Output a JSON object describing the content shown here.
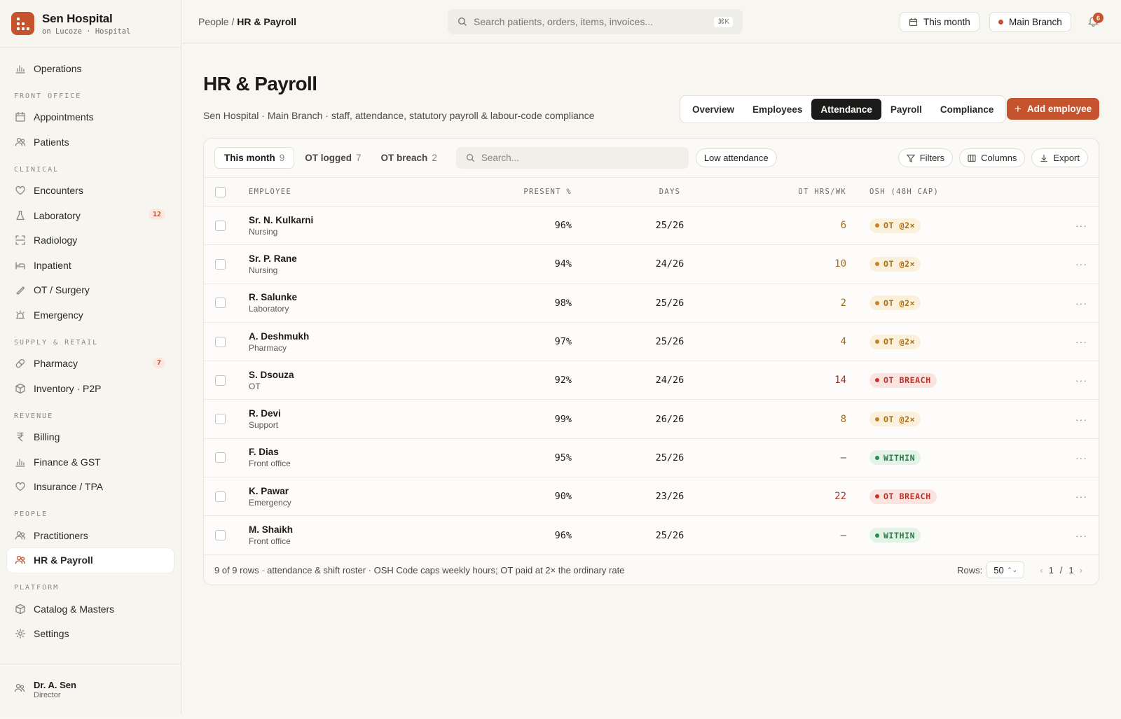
{
  "brand": {
    "name": "Sen Hospital",
    "sub": "on Lucoze · Hospital"
  },
  "sidebar": {
    "top": [
      {
        "label": "Operations",
        "icon": "bar-chart-icon"
      }
    ],
    "sections": [
      {
        "title": "FRONT OFFICE",
        "items": [
          {
            "label": "Appointments",
            "icon": "calendar-icon"
          },
          {
            "label": "Patients",
            "icon": "users-icon"
          }
        ]
      },
      {
        "title": "CLINICAL",
        "items": [
          {
            "label": "Encounters",
            "icon": "heart-icon"
          },
          {
            "label": "Laboratory",
            "icon": "flask-icon",
            "badge": "12"
          },
          {
            "label": "Radiology",
            "icon": "scan-icon"
          },
          {
            "label": "Inpatient",
            "icon": "bed-icon"
          },
          {
            "label": "OT / Surgery",
            "icon": "scalpel-icon"
          },
          {
            "label": "Emergency",
            "icon": "siren-icon"
          }
        ]
      },
      {
        "title": "SUPPLY & RETAIL",
        "items": [
          {
            "label": "Pharmacy",
            "icon": "pill-icon",
            "badge": "7"
          },
          {
            "label": "Inventory · P2P",
            "icon": "box-icon"
          }
        ]
      },
      {
        "title": "REVENUE",
        "items": [
          {
            "label": "Billing",
            "icon": "rupee-icon"
          },
          {
            "label": "Finance & GST",
            "icon": "bar-chart-icon"
          },
          {
            "label": "Insurance / TPA",
            "icon": "heart-icon"
          }
        ]
      },
      {
        "title": "PEOPLE",
        "items": [
          {
            "label": "Practitioners",
            "icon": "users-icon"
          },
          {
            "label": "HR & Payroll",
            "icon": "users-icon",
            "active": true
          }
        ]
      },
      {
        "title": "PLATFORM",
        "items": [
          {
            "label": "Catalog & Masters",
            "icon": "box-icon"
          },
          {
            "label": "Settings",
            "icon": "gear-icon"
          }
        ]
      }
    ],
    "user": {
      "name": "Dr. A. Sen",
      "role": "Director"
    }
  },
  "topbar": {
    "crumb_parent": "People /",
    "crumb_current": "HR & Payroll",
    "search_placeholder": "Search patients, orders, items, invoices...",
    "search_kbd": "⌘K",
    "period": "This month",
    "branch": "Main Branch",
    "notifications": "6",
    "colors": {
      "accent": "#c4532e"
    }
  },
  "page": {
    "title": "HR & Payroll",
    "subtitle": "Sen Hospital · Main Branch · staff, attendance, statutory payroll & labour-code compliance",
    "tabs": [
      {
        "label": "Overview"
      },
      {
        "label": "Employees"
      },
      {
        "label": "Attendance",
        "active": true
      },
      {
        "label": "Payroll"
      },
      {
        "label": "Compliance"
      }
    ],
    "add_button": "Add employee"
  },
  "toolbar": {
    "segments": [
      {
        "label": "This month",
        "count": "9",
        "active": true
      },
      {
        "label": "OT logged",
        "count": "7"
      },
      {
        "label": "OT breach",
        "count": "2"
      }
    ],
    "search_placeholder": "Search...",
    "chip": "Low attendance",
    "filters": "Filters",
    "columns": "Columns",
    "export": "Export"
  },
  "table": {
    "headers": {
      "employee": "EMPLOYEE",
      "present": "PRESENT %",
      "days": "DAYS",
      "ot": "OT HRS/WK",
      "osh": "OSH (48H CAP)"
    },
    "rows": [
      {
        "name": "Sr. N. Kulkarni",
        "dept": "Nursing",
        "present": "96%",
        "days": "25/26",
        "ot": "6",
        "osh": "OT @2×",
        "status": "ot"
      },
      {
        "name": "Sr. P. Rane",
        "dept": "Nursing",
        "present": "94%",
        "days": "24/26",
        "ot": "10",
        "osh": "OT @2×",
        "status": "ot"
      },
      {
        "name": "R. Salunke",
        "dept": "Laboratory",
        "present": "98%",
        "days": "25/26",
        "ot": "2",
        "osh": "OT @2×",
        "status": "ot"
      },
      {
        "name": "A. Deshmukh",
        "dept": "Pharmacy",
        "present": "97%",
        "days": "25/26",
        "ot": "4",
        "osh": "OT @2×",
        "status": "ot"
      },
      {
        "name": "S. Dsouza",
        "dept": "OT",
        "present": "92%",
        "days": "24/26",
        "ot": "14",
        "osh": "OT BREACH",
        "status": "breach"
      },
      {
        "name": "R. Devi",
        "dept": "Support",
        "present": "99%",
        "days": "26/26",
        "ot": "8",
        "osh": "OT @2×",
        "status": "ot"
      },
      {
        "name": "F. Dias",
        "dept": "Front office",
        "present": "95%",
        "days": "25/26",
        "ot": "—",
        "osh": "WITHIN",
        "status": "within"
      },
      {
        "name": "K. Pawar",
        "dept": "Emergency",
        "present": "90%",
        "days": "23/26",
        "ot": "22",
        "osh": "OT BREACH",
        "status": "breach"
      },
      {
        "name": "M. Shaikh",
        "dept": "Front office",
        "present": "96%",
        "days": "25/26",
        "ot": "—",
        "osh": "WITHIN",
        "status": "within"
      }
    ],
    "status_colors": {
      "ot": {
        "fg": "#a86f12",
        "bg": "#faf0dc",
        "dot": "#c4832a"
      },
      "breach": {
        "fg": "#b3332a",
        "bg": "#fbe4e0",
        "dot": "#c8362a"
      },
      "within": {
        "fg": "#2d7a45",
        "bg": "#e3f3e7",
        "dot": "#2f8a4c"
      }
    },
    "ot_colors": {
      "ot": "#a86f12",
      "breach": "#b3332a",
      "within": "#4a4741"
    }
  },
  "footer": {
    "summary": "9 of 9 rows · attendance & shift roster · OSH Code caps weekly hours; OT paid at 2× the ordinary rate",
    "rows_label": "Rows:",
    "rows_value": "50",
    "page_current": "1",
    "page_sep": "/",
    "page_total": "1"
  }
}
